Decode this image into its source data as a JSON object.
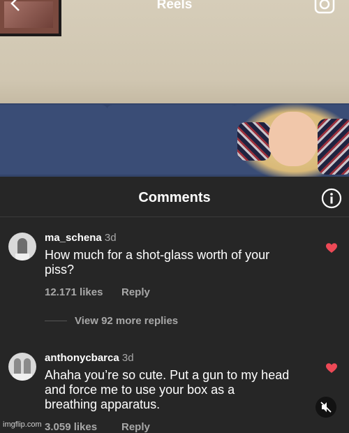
{
  "header": {
    "title": "Reels"
  },
  "comments_sheet": {
    "title": "Comments",
    "comments": [
      {
        "username": "ma_schena",
        "time": "3d",
        "text_line1": "How much for a shot-glass worth of your",
        "text_line2": "piss?",
        "likes": "12.171 likes",
        "reply_label": "Reply",
        "view_replies": "View 92 more replies"
      },
      {
        "username": "anthonycbarca",
        "time": "3d",
        "text_line1": "Ahaha you’re so cute. Put a gun to my head",
        "text_line2": "and force me to use your box as a",
        "text_line3": "breathing apparatus.",
        "likes": "3.059 likes",
        "reply_label": "Reply"
      }
    ]
  },
  "watermark": "imgflip.com",
  "colors": {
    "heart": "#ed4956",
    "background": "#262626",
    "text_secondary": "#a8a8a8"
  }
}
